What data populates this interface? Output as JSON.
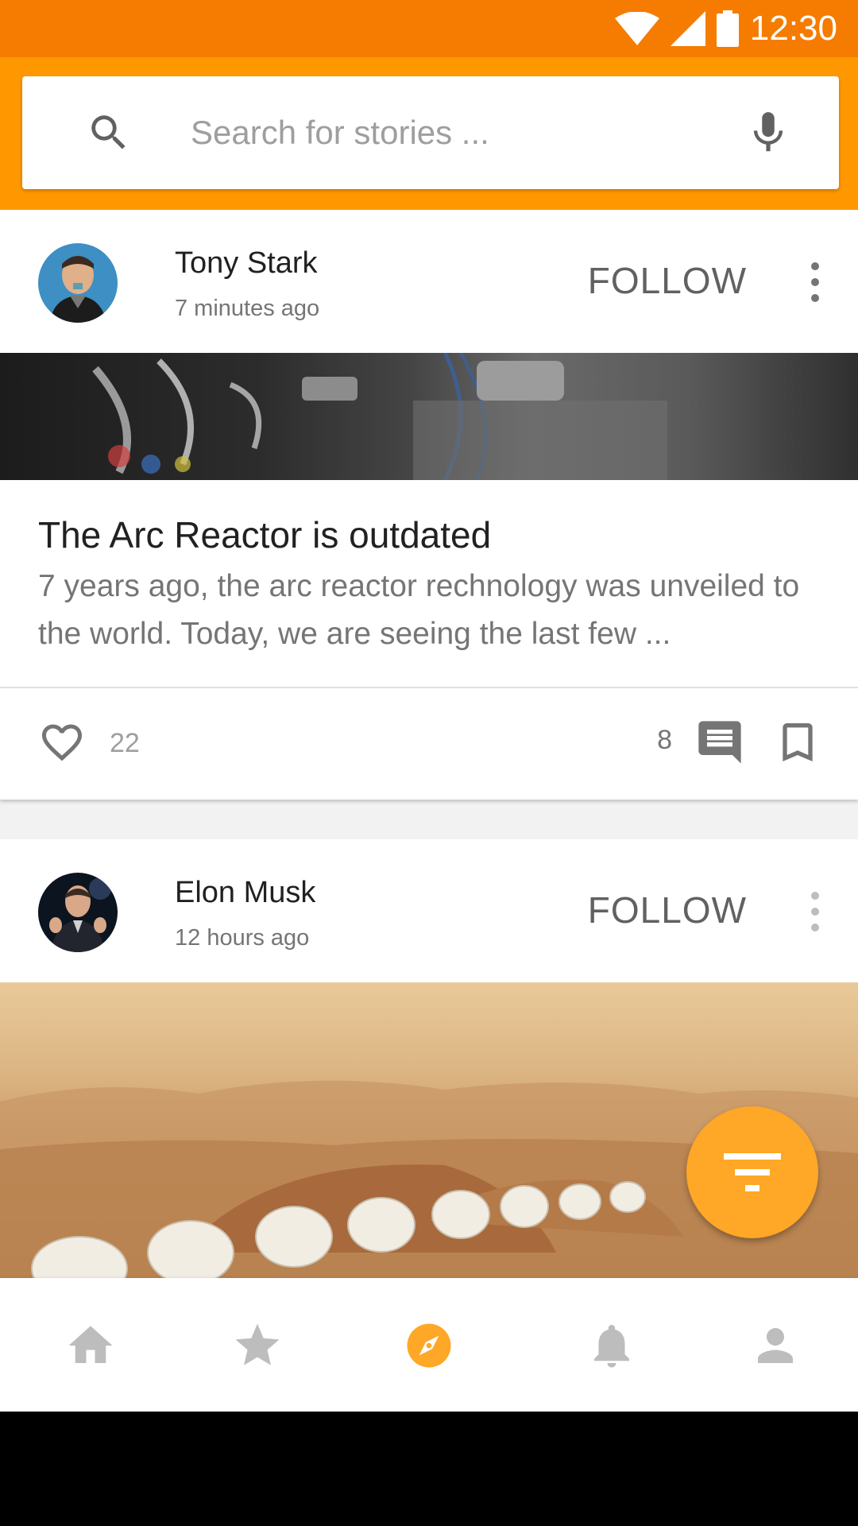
{
  "status_bar": {
    "time": "12:30",
    "color": "#f57c00"
  },
  "search": {
    "placeholder": "Search for stories ...",
    "value": "",
    "leading_icon": "search-icon",
    "trailing_icon": "mic-icon"
  },
  "posts": [
    {
      "author": "Tony Stark",
      "time": "7 minutes ago",
      "follow_label": "FOLLOW",
      "title": "The Arc Reactor is outdated",
      "excerpt": "7 years ago, the arc reactor rechnology was unveiled to the world. Today, we are seeing the last few ...",
      "likes": "22",
      "comments": "8"
    },
    {
      "author": "Elon Musk",
      "time": "12 hours ago",
      "follow_label": "FOLLOW"
    }
  ],
  "fab": {
    "icon": "filter-icon",
    "color": "#ffa726"
  },
  "bottom_nav": {
    "items": [
      {
        "name": "home",
        "icon": "home-icon",
        "active": false
      },
      {
        "name": "favorites",
        "icon": "star-icon",
        "active": false
      },
      {
        "name": "explore",
        "icon": "compass-icon",
        "active": true
      },
      {
        "name": "notifications",
        "icon": "bell-icon",
        "active": false
      },
      {
        "name": "profile",
        "icon": "person-icon",
        "active": false
      }
    ],
    "active_color": "#ffa726",
    "inactive_color": "#bdbdbd"
  },
  "colors": {
    "primary": "#ff9800",
    "primary_dark": "#f57c00"
  }
}
